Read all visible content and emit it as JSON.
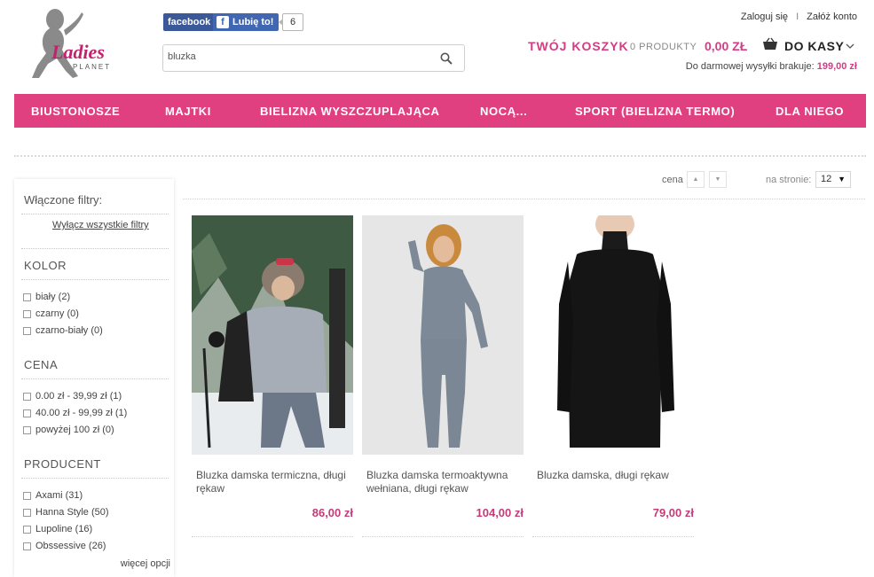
{
  "logo": {
    "text_line1": "Ladies",
    "text_line2": "PLANET"
  },
  "social": {
    "share_label": "facebook",
    "like_label": "Lubię to!",
    "like_count": "6"
  },
  "search": {
    "value": "bluzka",
    "icon": "search-icon"
  },
  "account": {
    "login": "Zaloguj się",
    "separator": "I",
    "register": "Załóż konto"
  },
  "cart": {
    "label": "TWÓJ KOSZYK",
    "count": "0 PRODUKTY",
    "total": "0,00 ZŁ",
    "checkout": "DO KASY",
    "shipping_label": "Do darmowej wysyłki brakuje:",
    "shipping_amount": "199,00 zł"
  },
  "nav": [
    "BIUSTONOSZE",
    "MAJTKI",
    "BIELIZNA WYSZCZUPLAJĄCA",
    "NOCĄ...",
    "SPORT (BIELIZNA TERMO)",
    "DLA NIEGO"
  ],
  "sidebar": {
    "title": "Włączone filtry:",
    "clear": "Wyłącz wszystkie filtry",
    "sections": [
      {
        "name": "KOLOR",
        "options": [
          "biały (2)",
          "czarny (0)",
          "czarno-biały (0)"
        ]
      },
      {
        "name": "CENA",
        "options": [
          "0.00 zł - 39,99 zł (1)",
          "40.00 zł - 99,99 zł (1)",
          "powyżej 100 zł (0)"
        ]
      },
      {
        "name": "PRODUCENT",
        "options": [
          "Axami (31)",
          "Hanna Style (50)",
          "Lupoline (16)",
          "Obssessive (26)"
        ]
      }
    ],
    "more": "więcej opcji"
  },
  "sort": {
    "label": "cena",
    "asc": "▲",
    "desc": "▼",
    "perpage_label": "na stronie:",
    "perpage_value": "12"
  },
  "products": [
    {
      "name": "Bluzka damska termiczna, długi rękaw",
      "price": "86,00 zł"
    },
    {
      "name": "Bluzka damska termoaktywna wełniana, długi rękaw",
      "price": "104,00 zł"
    },
    {
      "name": "Bluzka damska, długi rękaw",
      "price": "79,00 zł"
    }
  ],
  "colors": {
    "accent": "#e0407f",
    "price": "#c43b7a"
  }
}
